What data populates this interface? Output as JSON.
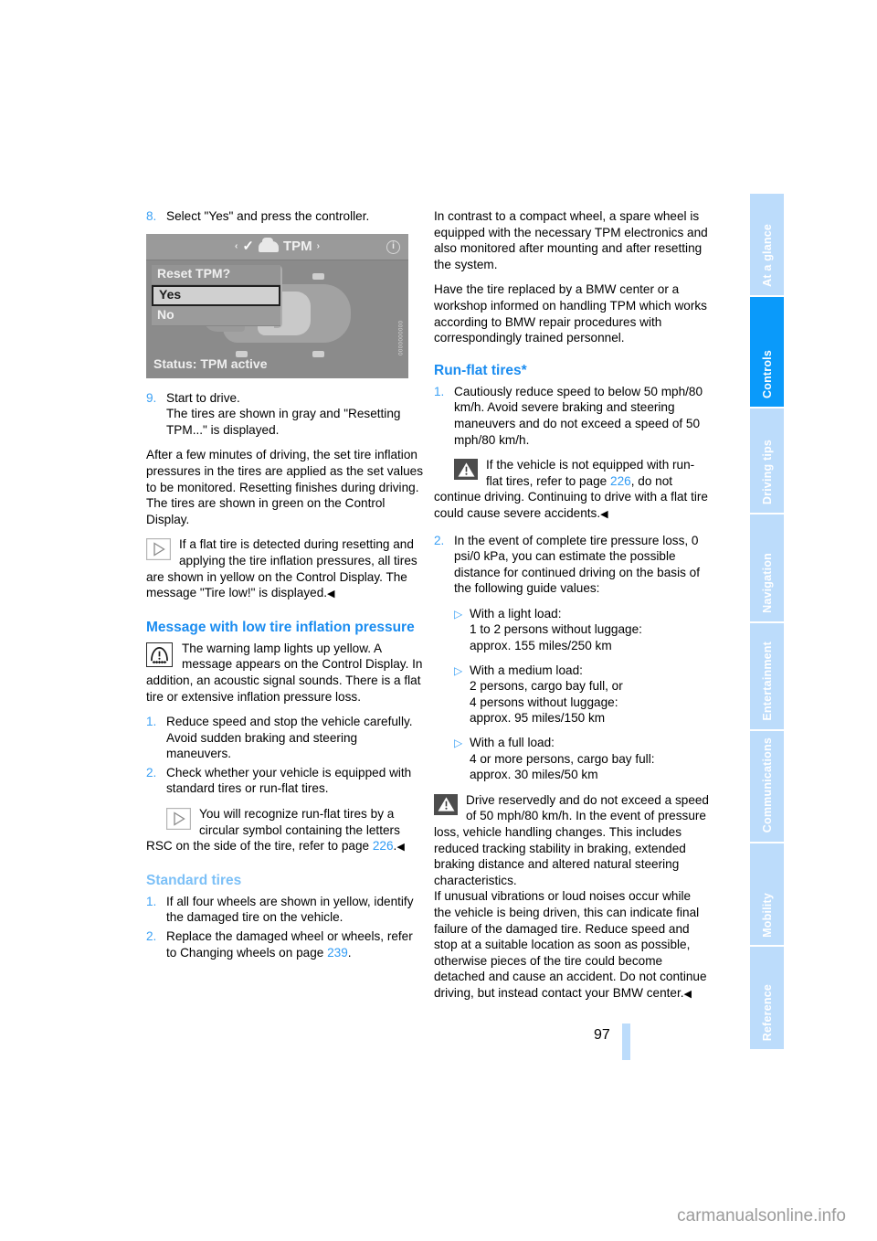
{
  "page": {
    "number": "97",
    "watermark": "carmanualsonline.info"
  },
  "tabs": [
    {
      "label": "At a glance",
      "active": false
    },
    {
      "label": "Controls",
      "active": true
    },
    {
      "label": "Driving tips",
      "active": false
    },
    {
      "label": "Navigation",
      "active": false
    },
    {
      "label": "Entertainment",
      "active": false
    },
    {
      "label": "Communications",
      "active": false
    },
    {
      "label": "Mobility",
      "active": false
    },
    {
      "label": "Reference",
      "active": false
    }
  ],
  "left": {
    "step8": {
      "num": "8.",
      "text": "Select \"Yes\" and press the controller."
    },
    "figure": {
      "title": "TPM",
      "arrow_left": "‹",
      "arrow_right": "›",
      "info_glyph": "i",
      "menu_title": "Reset TPM?",
      "option_yes": "Yes",
      "option_no": "No",
      "status": "Status: TPM active",
      "code": "0000000000"
    },
    "step9": {
      "num": "9.",
      "line1": "Start to drive.",
      "line2": "The tires are shown in gray and \"Resetting TPM...\" is displayed."
    },
    "para_after_steps": "After a few minutes of driving, the set tire inflation pressures in the tires are applied as the set values to be monitored. Resetting finishes during driving. The tires are shown in green on the Control Display.",
    "note1": "If a flat tire is detected during resetting and applying the tire inflation pressures, all tires are shown in yellow on the Control Display. The message \"Tire low!\" is displayed.",
    "heading_message": "Message with low tire inflation pressure",
    "warning_lamp_para": "The warning lamp lights up yellow. A message appears on the Control Display. In addition, an acoustic signal sounds. There is a flat tire or extensive inflation pressure loss.",
    "item1": {
      "num": "1.",
      "text": "Reduce speed and stop the vehicle carefully. Avoid sudden braking and steering maneuvers."
    },
    "item2": {
      "num": "2.",
      "text": "Check whether your vehicle is equipped with standard tires or run-flat tires."
    },
    "note2_part1": "You will recognize run-flat tires by a circular symbol containing the letters RSC on the side of the tire, refer to page ",
    "note2_link": "226",
    "note2_part2": ".",
    "heading_standard": "Standard tires",
    "std1": {
      "num": "1.",
      "text": "If all four wheels are shown in yellow, identify the damaged tire on the vehicle."
    },
    "std2": {
      "num": "2.",
      "part1": "Replace the damaged wheel or wheels, refer to Changing wheels on page ",
      "link": "239",
      "part2": "."
    }
  },
  "right": {
    "para1": "In contrast to a compact wheel, a spare wheel is equipped with the necessary TPM electronics and also monitored after mounting and after resetting the system.",
    "para2": "Have the tire replaced by a BMW center or a workshop informed on handling TPM which works according to BMW repair procedures with correspondingly trained personnel.",
    "heading_runflat": "Run-flat tires*",
    "item1": {
      "num": "1.",
      "text": "Cautiously reduce speed to below 50 mph/80 km/h. Avoid severe braking and steering maneuvers and do not exceed a speed of 50 mph/80 km/h."
    },
    "warn1_part1": "If the vehicle is not equipped with run-flat tires, refer to page ",
    "warn1_link": "226",
    "warn1_part2": ", do not continue driving. Continuing to drive with a flat tire could cause severe accidents.",
    "item2": {
      "num": "2.",
      "text": "In the event of complete tire pressure loss, 0 psi/0 kPa, you can estimate the possible distance for continued driving on the basis of the following guide values:"
    },
    "bullets": [
      {
        "marker": "▷",
        "lines": [
          "With a light load:",
          "1 to 2 persons without luggage:",
          "approx. 155 miles/250 km"
        ]
      },
      {
        "marker": "▷",
        "lines": [
          "With a medium load:",
          "2 persons, cargo bay full, or",
          "4 persons without luggage:",
          "approx. 95 miles/150 km"
        ]
      },
      {
        "marker": "▷",
        "lines": [
          "With a full load:",
          "4 or more persons, cargo bay full:",
          "approx. 30 miles/50 km"
        ]
      }
    ],
    "warn2_para1": "Drive reservedly and do not exceed a speed of 50 mph/80 km/h. In the event of pressure loss, vehicle handling changes. This includes reduced tracking stability in braking, extended braking distance and altered natural steering characteristics.",
    "warn2_para2": "If unusual vibrations or loud noises occur while the vehicle is being driven, this can indicate final failure of the damaged tire. Reduce speed and stop at a suitable location as soon as possible, otherwise pieces of the tire could become detached and cause an accident. Do not continue driving, but instead contact your BMW center.",
    "endmark": "◀"
  },
  "symbols": {
    "endmark": "◀",
    "note_triangle": "▷",
    "warn_exclaim": "!"
  }
}
